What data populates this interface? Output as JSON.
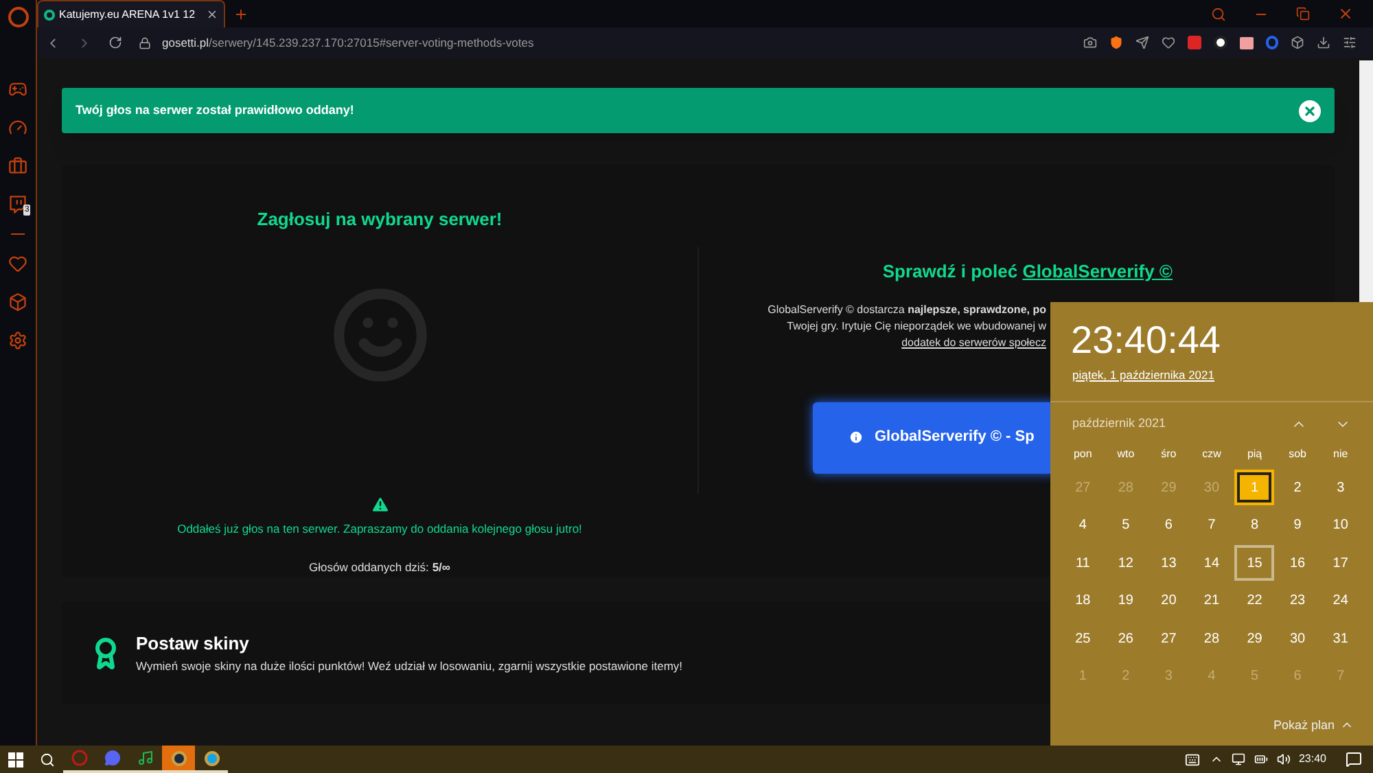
{
  "browser": {
    "tab": {
      "title": "Katujemy.eu ARENA 1v1 12",
      "selected": true
    },
    "url_host": "gosetti.pl",
    "url_path": "/serwery/145.239.237.170:27015#server-voting-methods-votes"
  },
  "sidebar": {
    "badge": "3"
  },
  "toast": {
    "message": "Twój głos na serwer został prawidłowo oddany!"
  },
  "vote": {
    "title": "Zagłosuj na wybrany serwer!",
    "status": "Oddałeś już głos na ten serwer. Zapraszamy do oddania kolejnego głosu jutro!",
    "votes_label": "Głosów oddanych dziś:",
    "votes_value": "5/∞"
  },
  "promo": {
    "title_prefix": "Sprawdź i poleć",
    "title_link": "GlobalServerify ©",
    "lines": [
      "GlobalServerify © dostarcza **najlepsze, sprawdzone, po**",
      "Twojej gry. Irytuje Cię nieporządek we wbudowanej w"
    ],
    "link": "dodatek do serwerów społecz",
    "button": "GlobalServerify © - Sp"
  },
  "skins": {
    "title": "Postaw skiny",
    "description": "Wymień swoje skiny na duże ilości punktów! Weź udział w losowaniu, zgarnij wszystkie postawione itemy!"
  },
  "calendar": {
    "time": "23:40:44",
    "date": "piątek, 1 października 2021",
    "month": "październik 2021",
    "weekdays": [
      "pon",
      "wto",
      "śro",
      "czw",
      "pią",
      "sob",
      "nie"
    ],
    "days": [
      {
        "label": "27",
        "current": false,
        "selected": false,
        "hovered": false
      },
      {
        "label": "28",
        "current": false,
        "selected": false,
        "hovered": false
      },
      {
        "label": "29",
        "current": false,
        "selected": false,
        "hovered": false
      },
      {
        "label": "30",
        "current": false,
        "selected": false,
        "hovered": false
      },
      {
        "label": "1",
        "current": true,
        "selected": true,
        "hovered": false
      },
      {
        "label": "2",
        "current": true,
        "selected": false,
        "hovered": false
      },
      {
        "label": "3",
        "current": true,
        "selected": false,
        "hovered": false
      },
      {
        "label": "4",
        "current": true,
        "selected": false,
        "hovered": false
      },
      {
        "label": "5",
        "current": true,
        "selected": false,
        "hovered": false
      },
      {
        "label": "6",
        "current": true,
        "selected": false,
        "hovered": false
      },
      {
        "label": "7",
        "current": true,
        "selected": false,
        "hovered": false
      },
      {
        "label": "8",
        "current": true,
        "selected": false,
        "hovered": false
      },
      {
        "label": "9",
        "current": true,
        "selected": false,
        "hovered": false
      },
      {
        "label": "10",
        "current": true,
        "selected": false,
        "hovered": false
      },
      {
        "label": "11",
        "current": true,
        "selected": false,
        "hovered": false
      },
      {
        "label": "12",
        "current": true,
        "selected": false,
        "hovered": false
      },
      {
        "label": "13",
        "current": true,
        "selected": false,
        "hovered": false
      },
      {
        "label": "14",
        "current": true,
        "selected": false,
        "hovered": false
      },
      {
        "label": "15",
        "current": true,
        "selected": false,
        "hovered": true
      },
      {
        "label": "16",
        "current": true,
        "selected": false,
        "hovered": false
      },
      {
        "label": "17",
        "current": true,
        "selected": false,
        "hovered": false
      },
      {
        "label": "18",
        "current": true,
        "selected": false,
        "hovered": false
      },
      {
        "label": "19",
        "current": true,
        "selected": false,
        "hovered": false
      },
      {
        "label": "20",
        "current": true,
        "selected": false,
        "hovered": false
      },
      {
        "label": "21",
        "current": true,
        "selected": false,
        "hovered": false
      },
      {
        "label": "22",
        "current": true,
        "selected": false,
        "hovered": false
      },
      {
        "label": "23",
        "current": true,
        "selected": false,
        "hovered": false
      },
      {
        "label": "24",
        "current": true,
        "selected": false,
        "hovered": false
      },
      {
        "label": "25",
        "current": true,
        "selected": false,
        "hovered": false
      },
      {
        "label": "26",
        "current": true,
        "selected": false,
        "hovered": false
      },
      {
        "label": "27",
        "current": true,
        "selected": false,
        "hovered": false
      },
      {
        "label": "28",
        "current": true,
        "selected": false,
        "hovered": false
      },
      {
        "label": "29",
        "current": true,
        "selected": false,
        "hovered": false
      },
      {
        "label": "30",
        "current": true,
        "selected": false,
        "hovered": false
      },
      {
        "label": "31",
        "current": true,
        "selected": false,
        "hovered": false
      },
      {
        "label": "1",
        "current": false,
        "selected": false,
        "hovered": false
      },
      {
        "label": "2",
        "current": false,
        "selected": false,
        "hovered": false
      },
      {
        "label": "3",
        "current": false,
        "selected": false,
        "hovered": false
      },
      {
        "label": "4",
        "current": false,
        "selected": false,
        "hovered": false
      },
      {
        "label": "5",
        "current": false,
        "selected": false,
        "hovered": false
      },
      {
        "label": "6",
        "current": false,
        "selected": false,
        "hovered": false
      },
      {
        "label": "7",
        "current": false,
        "selected": false,
        "hovered": false
      }
    ],
    "footer": "Pokaż plan"
  },
  "taskbar": {
    "time": "23:40",
    "apps": [
      {
        "kind": "browser",
        "active": false,
        "running": true
      },
      {
        "kind": "chat",
        "active": false,
        "running": true
      },
      {
        "kind": "music",
        "active": false,
        "running": true
      },
      {
        "kind": "game",
        "active": true,
        "running": true
      },
      {
        "kind": "launcher",
        "active": false,
        "running": true
      }
    ]
  }
}
